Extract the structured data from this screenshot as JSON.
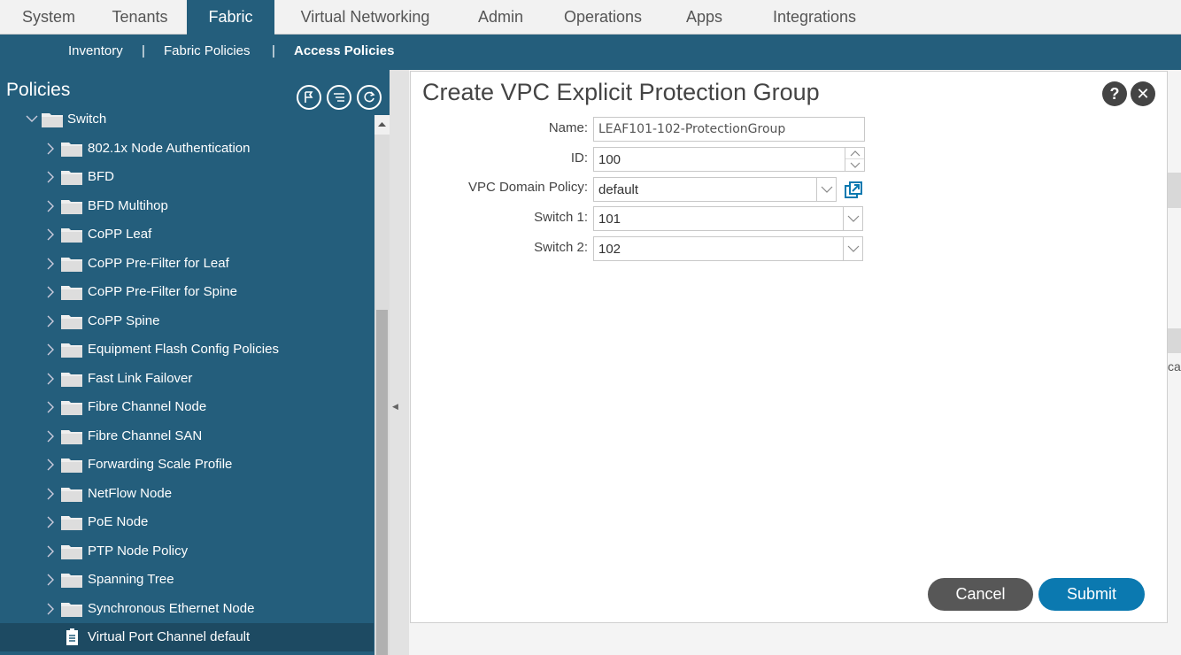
{
  "topnav": {
    "tabs": [
      "System",
      "Tenants",
      "Fabric",
      "Virtual Networking",
      "Admin",
      "Operations",
      "Apps",
      "Integrations"
    ],
    "active": "Fabric"
  },
  "subnav": {
    "items": [
      "Inventory",
      "Fabric Policies",
      "Access Policies"
    ],
    "separator": "|",
    "active": "Access Policies"
  },
  "sidebar": {
    "title": "Policies",
    "tools": [
      "pin-up-icon",
      "filter-list-icon",
      "refresh-icon"
    ],
    "root": {
      "label": "Switch",
      "expanded": true
    },
    "items": [
      "802.1x Node Authentication",
      "BFD",
      "BFD Multihop",
      "CoPP Leaf",
      "CoPP Pre-Filter for Leaf",
      "CoPP Pre-Filter for Spine",
      "CoPP Spine",
      "Equipment Flash Config Policies",
      "Fast Link Failover",
      "Fibre Channel Node",
      "Fibre Channel SAN",
      "Forwarding Scale Profile",
      "NetFlow Node",
      "PoE Node",
      "PTP Node Policy",
      "Spanning Tree",
      "Synchronous Ethernet Node"
    ],
    "selected": "Virtual Port Channel default"
  },
  "background": {
    "cut_text": "ca"
  },
  "modal": {
    "title": "Create VPC Explicit Protection Group",
    "help": "?",
    "close": "✕",
    "name_label": "Name:",
    "name_value": "LEAF101-102-ProtectionGroup",
    "id_label": "ID:",
    "id_value": "100",
    "domain_label": "VPC Domain Policy:",
    "domain_value": "default",
    "switch1_label": "Switch 1:",
    "switch1_value": "101",
    "switch2_label": "Switch 2:",
    "switch2_value": "102",
    "cancel": "Cancel",
    "submit": "Submit"
  },
  "colors": {
    "nav_blue": "#245e7c",
    "selected_row": "#1d4a62",
    "submit_blue": "#0b79b0",
    "cancel_gray": "#575757",
    "link_icon": "#0b79b0"
  }
}
